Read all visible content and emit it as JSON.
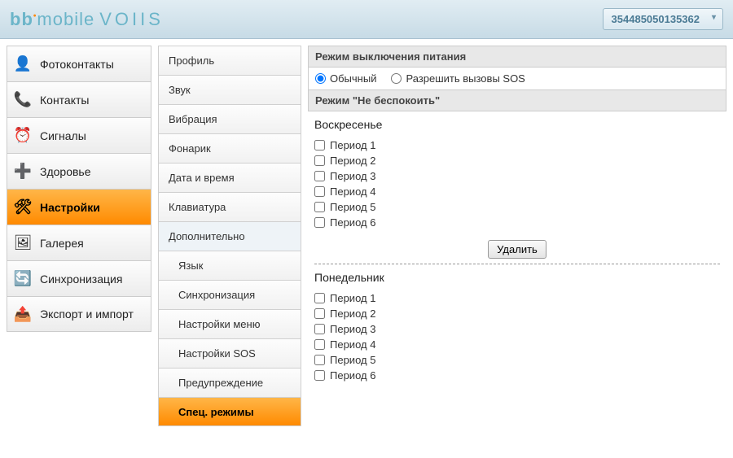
{
  "header": {
    "logo_bb": "bb",
    "logo_mobile": "mobile",
    "logo_voiis": "VOIIS",
    "device_id": "354485050135362"
  },
  "nav1": [
    {
      "icon": "👤",
      "label": "Фотоконтакты",
      "name": "nav-photo-contacts"
    },
    {
      "icon": "📞",
      "label": "Контакты",
      "name": "nav-contacts"
    },
    {
      "icon": "⏰",
      "label": "Сигналы",
      "name": "nav-signals"
    },
    {
      "icon": "➕",
      "label": "Здоровье",
      "name": "nav-health"
    },
    {
      "icon": "🛠",
      "label": "Настройки",
      "name": "nav-settings",
      "active": true
    },
    {
      "icon": "🖼",
      "label": "Галерея",
      "name": "nav-gallery"
    },
    {
      "icon": "🔄",
      "label": "Синхронизация",
      "name": "nav-sync"
    },
    {
      "icon": "📤",
      "label": "Экспорт и импорт",
      "name": "nav-export"
    }
  ],
  "nav2": [
    {
      "label": "Профиль"
    },
    {
      "label": "Звук"
    },
    {
      "label": "Вибрация"
    },
    {
      "label": "Фонарик"
    },
    {
      "label": "Дата и время"
    },
    {
      "label": "Клавиатура"
    },
    {
      "label": "Дополнительно",
      "expanded": true
    },
    {
      "label": "Язык",
      "sub": true
    },
    {
      "label": "Синхронизация",
      "sub": true
    },
    {
      "label": "Настройки меню",
      "sub": true
    },
    {
      "label": "Настройки SOS",
      "sub": true
    },
    {
      "label": "Предупреждение",
      "sub": true
    },
    {
      "label": "Спец. режимы",
      "sub": true,
      "active": true
    }
  ],
  "content": {
    "power_title": "Режим выключения питания",
    "radio_normal": "Обычный",
    "radio_sos": "Разрешить вызовы SOS",
    "dnd_title": "Режим \"Не беспокоить\"",
    "delete_btn": "Удалить",
    "days": [
      {
        "name": "Воскресенье",
        "periods": [
          "Период 1",
          "Период 2",
          "Период 3",
          "Период 4",
          "Период 5",
          "Период 6"
        ],
        "show_delete": true
      },
      {
        "name": "Понедельник",
        "periods": [
          "Период 1",
          "Период 2",
          "Период 3",
          "Период 4",
          "Период 5",
          "Период 6"
        ],
        "show_delete": false
      }
    ]
  }
}
